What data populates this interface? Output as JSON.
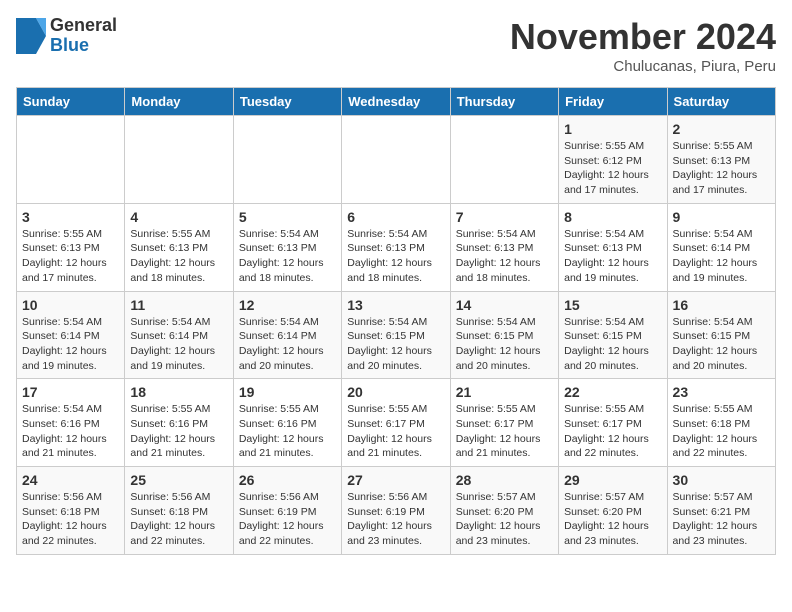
{
  "logo": {
    "line1": "General",
    "line2": "Blue"
  },
  "title": "November 2024",
  "subtitle": "Chulucanas, Piura, Peru",
  "days_of_week": [
    "Sunday",
    "Monday",
    "Tuesday",
    "Wednesday",
    "Thursday",
    "Friday",
    "Saturday"
  ],
  "weeks": [
    [
      {
        "day": "",
        "info": ""
      },
      {
        "day": "",
        "info": ""
      },
      {
        "day": "",
        "info": ""
      },
      {
        "day": "",
        "info": ""
      },
      {
        "day": "",
        "info": ""
      },
      {
        "day": "1",
        "info": "Sunrise: 5:55 AM\nSunset: 6:12 PM\nDaylight: 12 hours and 17 minutes."
      },
      {
        "day": "2",
        "info": "Sunrise: 5:55 AM\nSunset: 6:13 PM\nDaylight: 12 hours and 17 minutes."
      }
    ],
    [
      {
        "day": "3",
        "info": "Sunrise: 5:55 AM\nSunset: 6:13 PM\nDaylight: 12 hours and 17 minutes."
      },
      {
        "day": "4",
        "info": "Sunrise: 5:55 AM\nSunset: 6:13 PM\nDaylight: 12 hours and 18 minutes."
      },
      {
        "day": "5",
        "info": "Sunrise: 5:54 AM\nSunset: 6:13 PM\nDaylight: 12 hours and 18 minutes."
      },
      {
        "day": "6",
        "info": "Sunrise: 5:54 AM\nSunset: 6:13 PM\nDaylight: 12 hours and 18 minutes."
      },
      {
        "day": "7",
        "info": "Sunrise: 5:54 AM\nSunset: 6:13 PM\nDaylight: 12 hours and 18 minutes."
      },
      {
        "day": "8",
        "info": "Sunrise: 5:54 AM\nSunset: 6:13 PM\nDaylight: 12 hours and 19 minutes."
      },
      {
        "day": "9",
        "info": "Sunrise: 5:54 AM\nSunset: 6:14 PM\nDaylight: 12 hours and 19 minutes."
      }
    ],
    [
      {
        "day": "10",
        "info": "Sunrise: 5:54 AM\nSunset: 6:14 PM\nDaylight: 12 hours and 19 minutes."
      },
      {
        "day": "11",
        "info": "Sunrise: 5:54 AM\nSunset: 6:14 PM\nDaylight: 12 hours and 19 minutes."
      },
      {
        "day": "12",
        "info": "Sunrise: 5:54 AM\nSunset: 6:14 PM\nDaylight: 12 hours and 20 minutes."
      },
      {
        "day": "13",
        "info": "Sunrise: 5:54 AM\nSunset: 6:15 PM\nDaylight: 12 hours and 20 minutes."
      },
      {
        "day": "14",
        "info": "Sunrise: 5:54 AM\nSunset: 6:15 PM\nDaylight: 12 hours and 20 minutes."
      },
      {
        "day": "15",
        "info": "Sunrise: 5:54 AM\nSunset: 6:15 PM\nDaylight: 12 hours and 20 minutes."
      },
      {
        "day": "16",
        "info": "Sunrise: 5:54 AM\nSunset: 6:15 PM\nDaylight: 12 hours and 20 minutes."
      }
    ],
    [
      {
        "day": "17",
        "info": "Sunrise: 5:54 AM\nSunset: 6:16 PM\nDaylight: 12 hours and 21 minutes."
      },
      {
        "day": "18",
        "info": "Sunrise: 5:55 AM\nSunset: 6:16 PM\nDaylight: 12 hours and 21 minutes."
      },
      {
        "day": "19",
        "info": "Sunrise: 5:55 AM\nSunset: 6:16 PM\nDaylight: 12 hours and 21 minutes."
      },
      {
        "day": "20",
        "info": "Sunrise: 5:55 AM\nSunset: 6:17 PM\nDaylight: 12 hours and 21 minutes."
      },
      {
        "day": "21",
        "info": "Sunrise: 5:55 AM\nSunset: 6:17 PM\nDaylight: 12 hours and 21 minutes."
      },
      {
        "day": "22",
        "info": "Sunrise: 5:55 AM\nSunset: 6:17 PM\nDaylight: 12 hours and 22 minutes."
      },
      {
        "day": "23",
        "info": "Sunrise: 5:55 AM\nSunset: 6:18 PM\nDaylight: 12 hours and 22 minutes."
      }
    ],
    [
      {
        "day": "24",
        "info": "Sunrise: 5:56 AM\nSunset: 6:18 PM\nDaylight: 12 hours and 22 minutes."
      },
      {
        "day": "25",
        "info": "Sunrise: 5:56 AM\nSunset: 6:18 PM\nDaylight: 12 hours and 22 minutes."
      },
      {
        "day": "26",
        "info": "Sunrise: 5:56 AM\nSunset: 6:19 PM\nDaylight: 12 hours and 22 minutes."
      },
      {
        "day": "27",
        "info": "Sunrise: 5:56 AM\nSunset: 6:19 PM\nDaylight: 12 hours and 23 minutes."
      },
      {
        "day": "28",
        "info": "Sunrise: 5:57 AM\nSunset: 6:20 PM\nDaylight: 12 hours and 23 minutes."
      },
      {
        "day": "29",
        "info": "Sunrise: 5:57 AM\nSunset: 6:20 PM\nDaylight: 12 hours and 23 minutes."
      },
      {
        "day": "30",
        "info": "Sunrise: 5:57 AM\nSunset: 6:21 PM\nDaylight: 12 hours and 23 minutes."
      }
    ]
  ]
}
